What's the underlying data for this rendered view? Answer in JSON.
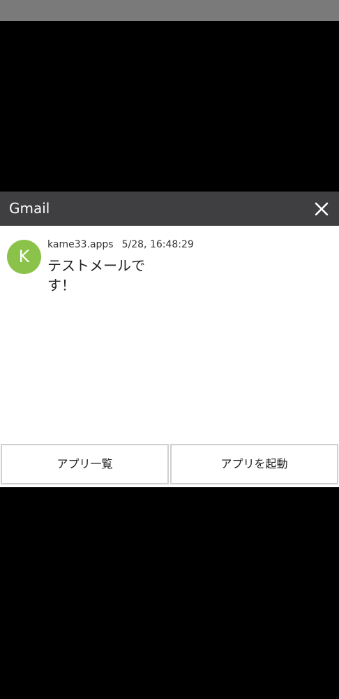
{
  "colors": {
    "status_bar": "#7a7a7a",
    "header": "#3f3f41",
    "avatar": "#8bc34a",
    "scrim": "#000000"
  },
  "dialog": {
    "title": "Gmail",
    "close_icon": "close-icon"
  },
  "message": {
    "avatar_letter": "K",
    "sender": "kame33.apps",
    "timestamp": "5/28, 16:48:29",
    "body": "テストメールです！"
  },
  "actions": {
    "app_list_label": "アプリ一覧",
    "launch_app_label": "アプリを起動"
  }
}
